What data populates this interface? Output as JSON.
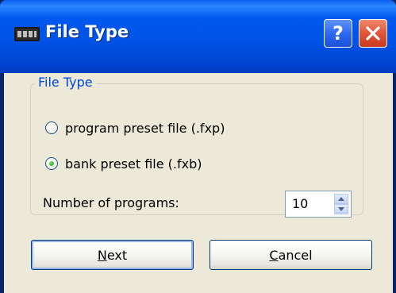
{
  "window": {
    "title": "File Type",
    "icon": "vst-plugin-icon",
    "help_glyph": "?",
    "close_glyph": "✕"
  },
  "group": {
    "legend": "File Type",
    "options": [
      {
        "label": "program preset file (.fxp)",
        "selected": false
      },
      {
        "label": "bank preset file (.fxb)",
        "selected": true
      }
    ]
  },
  "programs": {
    "label": "Number of programs:",
    "value": "10"
  },
  "buttons": {
    "next_label": "Next",
    "cancel_label": "Cancel"
  },
  "colors": {
    "titlebar": "#0054e3",
    "legend_text": "#0046d5",
    "radio_selected": "#21a121",
    "face": "#ece9d8"
  }
}
